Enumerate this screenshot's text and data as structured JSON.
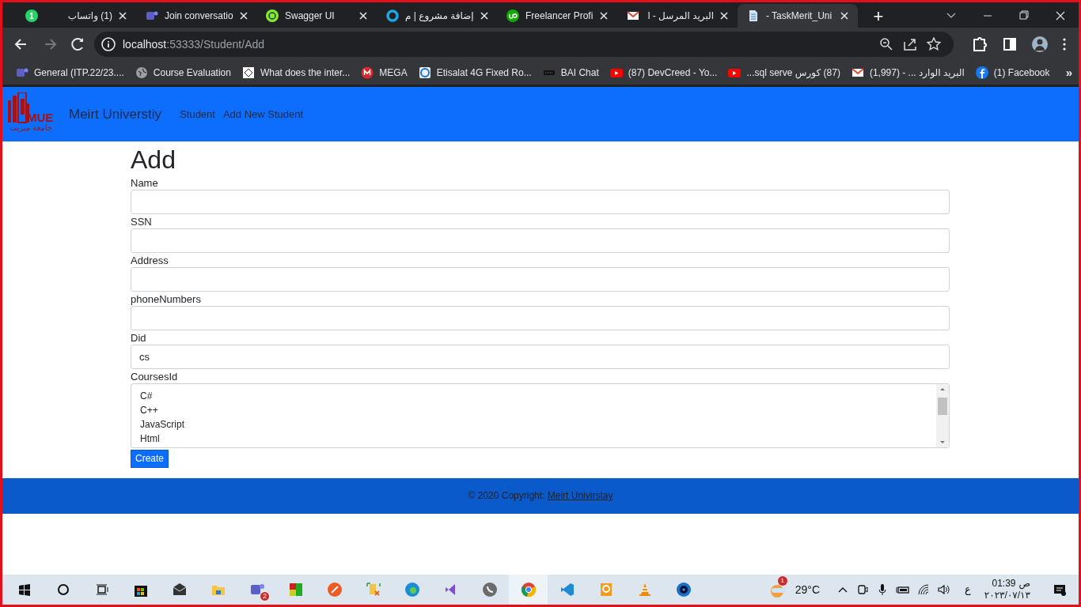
{
  "browser": {
    "tabs": [
      {
        "title": "(1) واتساب",
        "badge": "1",
        "selected": false
      },
      {
        "title": "Join conversatio",
        "selected": false
      },
      {
        "title": "Swagger UI",
        "selected": false
      },
      {
        "title": "إضافة مشروع | م",
        "selected": false
      },
      {
        "title": "Freelancer Profi",
        "selected": false
      },
      {
        "title": "البريد المرسل - l",
        "selected": false
      },
      {
        "title": "- TaskMerit_Uni",
        "selected": true
      }
    ],
    "new_tab": "+",
    "address": {
      "host": "localhost",
      "path": ":53333/Student/Add"
    },
    "bookmarks": [
      "General (ITP.22/23....",
      "Course Evaluation",
      "What does the inter...",
      "MEGA",
      "Etisalat 4G Fixed Ro...",
      "BAI Chat",
      "(87) DevCreed - Yo...",
      "(87) كورس sql serve...",
      "البريد الوارد ... - (1,997)",
      "(1) Facebook"
    ],
    "bookmarks_more": "»"
  },
  "navbar": {
    "logo": {
      "text": "MUE",
      "subtext": "جامعة ميريت"
    },
    "brand": "Meirt Universtiy",
    "links": [
      "Student",
      "Add New Student"
    ]
  },
  "form": {
    "heading": "Add",
    "fields": [
      {
        "label": "Name"
      },
      {
        "label": "SSN"
      },
      {
        "label": "Address"
      },
      {
        "label": "phoneNumbers"
      },
      {
        "label": "Did",
        "value": "cs"
      }
    ],
    "courses": {
      "label": "CoursesId",
      "options": [
        "C#",
        "C++",
        "JavaScript",
        "Html"
      ]
    },
    "submit": "Create"
  },
  "footer": {
    "text": "© 2020 Copyright: ",
    "link": "Meirt Univirstay"
  },
  "taskbar": {
    "teams_badge": "2",
    "weather_badge": "1",
    "temperature": "29°C",
    "language": "ع",
    "time": "01:39",
    "period": "ص",
    "date": "٢٠٢٣/٠٧/١٣"
  }
}
